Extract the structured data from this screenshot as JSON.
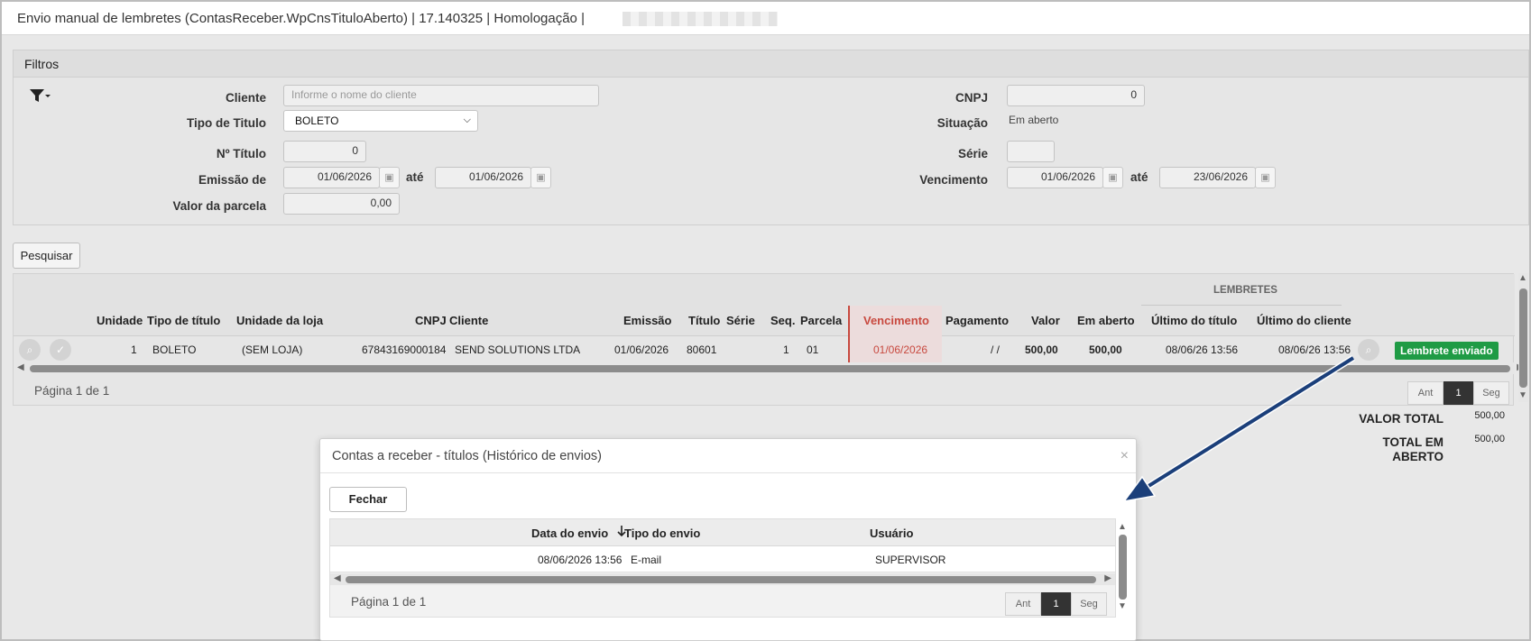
{
  "window": {
    "title": "Envio manual de lembretes (ContasReceber.WpCnsTituloAberto) | 17.140325 | Homologação |"
  },
  "filters": {
    "section_title": "Filtros",
    "cliente_label": "Cliente",
    "cliente_placeholder": "Informe o nome do cliente",
    "tipo_titulo_label": "Tipo de Titulo",
    "tipo_titulo_value": "BOLETO",
    "numero_titulo_label": "Nº Título",
    "numero_titulo_value": "0",
    "emissao_label": "Emissão de",
    "emissao_de": "01/06/2026",
    "ate_label": "até",
    "emissao_ate": "01/06/2026",
    "valor_parcela_label": "Valor da parcela",
    "valor_parcela_value": "0,00",
    "cnpj_label": "CNPJ",
    "cnpj_value": "0",
    "situacao_label": "Situação",
    "situacao_value": "Em aberto",
    "serie_label": "Série",
    "serie_value": "",
    "vencimento_label": "Vencimento",
    "vencimento_de": "01/06/2026",
    "vencimento_ate": "23/06/2026"
  },
  "actions": {
    "pesquisar_label": "Pesquisar"
  },
  "grid": {
    "group_header": "LEMBRETES",
    "columns": {
      "unidade": "Unidade",
      "tipo_titulo": "Tipo de título",
      "unidade_loja": "Unidade da loja",
      "cnpj": "CNPJ",
      "cliente": "Cliente",
      "emissao": "Emissão",
      "titulo": "Título",
      "serie": "Série",
      "seq": "Seq.",
      "parcela": "Parcela",
      "vencimento": "Vencimento",
      "pagamento": "Pagamento",
      "valor": "Valor",
      "em_aberto": "Em aberto",
      "ultimo_titulo": "Último do título",
      "ultimo_cliente": "Último do cliente"
    },
    "row": {
      "unidade": "1",
      "tipo_titulo": "BOLETO",
      "unidade_loja": "(SEM LOJA)",
      "cnpj": "67843169000184",
      "cliente": "SEND SOLUTIONS LTDA",
      "emissao": "01/06/2026",
      "titulo": "80601",
      "serie": "",
      "seq": "1",
      "parcela": "01",
      "vencimento": "01/06/2026",
      "pagamento": "/ /",
      "valor": "500,00",
      "em_aberto": "500,00",
      "ultimo_titulo": "08/06/26 13:56",
      "ultimo_cliente": "08/06/26 13:56",
      "status_badge": "Lembrete enviado"
    },
    "pager": {
      "page_text": "Página 1 de 1",
      "prev": "Ant",
      "current": "1",
      "next": "Seg"
    }
  },
  "totals": {
    "valor_total_label": "VALOR TOTAL",
    "valor_total_value": "500,00",
    "total_aberto_label_1": "TOTAL EM",
    "total_aberto_label_2": "ABERTO",
    "total_aberto_value": "500,00"
  },
  "modal": {
    "title": "Contas a receber - títulos (Histórico de envios)",
    "close_glyph": "×",
    "fechar_label": "Fechar",
    "columns": {
      "data_envio": "Data do envio",
      "tipo_envio": "Tipo do envio",
      "usuario": "Usuário"
    },
    "row": {
      "data_envio": "08/06/2026 13:56",
      "tipo_envio": "E-mail",
      "usuario": "SUPERVISOR"
    },
    "pager": {
      "page_text": "Página 1 de 1",
      "prev": "Ant",
      "current": "1",
      "next": "Seg"
    }
  },
  "colors": {
    "accent_red": "#c8493f",
    "badge_green": "#1f9b45",
    "arrow_blue": "#1b3f7a"
  }
}
